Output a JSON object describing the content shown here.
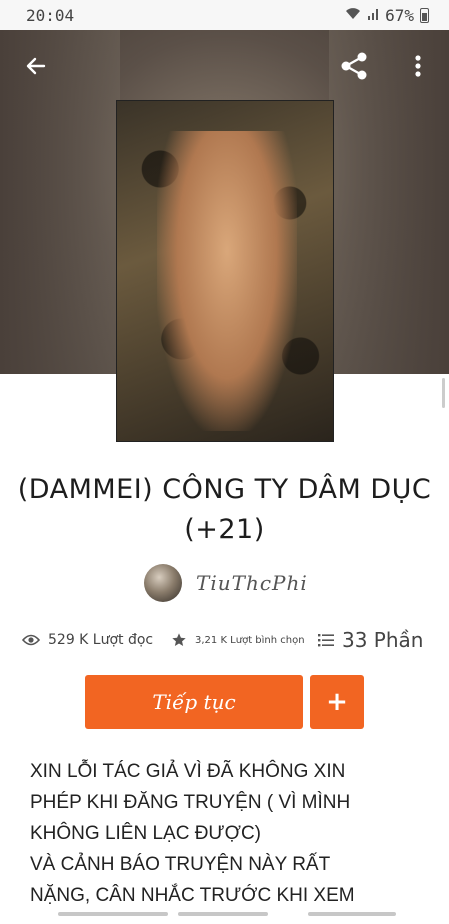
{
  "status_bar": {
    "time": "20:04",
    "battery": "67%"
  },
  "icons": {
    "back": "arrow-left-icon",
    "share": "share-icon",
    "more": "more-vertical-icon",
    "reads": "eye-icon",
    "votes": "star-icon",
    "parts": "list-icon"
  },
  "story": {
    "title_line1": "(DAMMEI) CÔNG TY DÂM DỤC",
    "title_line2": "(+21)",
    "author": "TiuThcPhi"
  },
  "stats": {
    "reads": "529 K Lượt đọc",
    "votes": "3,21 K Lượt bình chọn",
    "parts": "33 Phần"
  },
  "actions": {
    "continue_label": "Tiếp tục",
    "add_label": "+"
  },
  "description": {
    "line1": "XIN LỖI TÁC GIẢ VÌ ĐÃ KHÔNG XIN",
    "line2": "PHÉP KHI ĐĂNG TRUYỆN ( VÌ MÌNH",
    "line3": "KHÔNG LIÊN LẠC ĐƯỢC)",
    "line4": "VÀ CẢNH BÁO TRUYỆN NÀY RẤT",
    "line5": "NẶNG, CÂN NHẮC TRƯỚC KHI XEM"
  },
  "colors": {
    "accent": "#f26522"
  }
}
